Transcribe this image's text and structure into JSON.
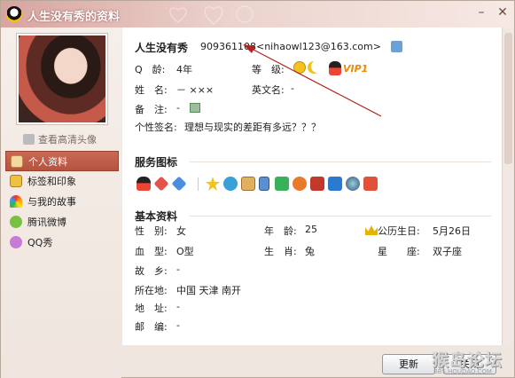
{
  "window": {
    "title": "人生没有秀的资料",
    "min_glyph": "–",
    "close_glyph": "✕"
  },
  "left": {
    "view_hd_avatar": "查看高清头像",
    "nav": [
      {
        "label": "个人资料",
        "icon": "person-card-icon",
        "active": true
      },
      {
        "label": "标签和印象",
        "icon": "tag-icon",
        "active": false
      },
      {
        "label": "与我的故事",
        "icon": "rainbow-icon",
        "active": false
      },
      {
        "label": "腾讯微博",
        "icon": "weibo-icon",
        "active": false
      },
      {
        "label": "QQ秀",
        "icon": "qq-show-icon",
        "active": false
      }
    ]
  },
  "profile": {
    "nickname": "人生没有秀",
    "qq_and_email": "909361108<nihaowl123@163.com>",
    "rows": {
      "q_age_label": "Q　龄:",
      "q_age_value": "4年",
      "level_label": "等　级:",
      "name_label": "姓　名:",
      "name_value": "－ ×××",
      "english_name_label": "英文名:",
      "english_name_value": "-",
      "note_label": "备　注:",
      "note_value": "-",
      "signature_label": "个性签名:",
      "signature_value": "理想与现实的差距有多远？？？"
    },
    "vip_text": "VIP1"
  },
  "services": {
    "title": "服务图标",
    "icons": [
      "qq-penguin-icon",
      "red-diamond-icon",
      "blue-diamond-icon",
      "star-icon",
      "qzone-icon",
      "member-icon",
      "phone-icon",
      "game-icon",
      "pet-icon",
      "music-icon",
      "camera-icon",
      "globe-icon",
      "mail-icon"
    ]
  },
  "basic": {
    "title": "基本资料",
    "gender_label": "性　别:",
    "gender_value": "女",
    "age_label": "年　龄:",
    "age_value": "25",
    "birthday_label": "公历生日:",
    "birthday_value": "5月26日",
    "blood_label": "血　型:",
    "blood_value": "O型",
    "zodiac_label": "生　肖:",
    "zodiac_value": "兔",
    "constellation_label": "星　　座:",
    "constellation_value": "双子座",
    "hometown_label": "故　乡:",
    "hometown_value": "-",
    "location_label": "所在地:",
    "location_value": "中国 天津 南开",
    "address_label": "地　址:",
    "address_value": "-",
    "postcode_label": "邮　编:",
    "postcode_value": "-"
  },
  "buttons": {
    "refresh": "更新",
    "close": "关闭"
  },
  "watermark": {
    "big": "猴岛论坛",
    "small": "BBS.HOUDAO.COM"
  },
  "colors": {
    "nav_active": "#c0604c",
    "title_gradient_start": "#d8a4a0",
    "vip_orange": "#f08a00",
    "annotation_arrow": "#b1231f"
  }
}
